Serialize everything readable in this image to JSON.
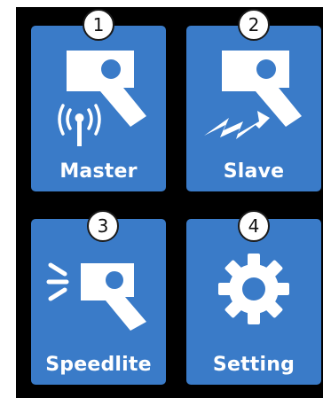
{
  "modes": [
    {
      "number": "1",
      "label": "Master",
      "icon": "master-flash-icon"
    },
    {
      "number": "2",
      "label": "Slave",
      "icon": "slave-flash-icon"
    },
    {
      "number": "3",
      "label": "Speedlite",
      "icon": "speedlite-flash-icon"
    },
    {
      "number": "4",
      "label": "Setting",
      "icon": "gear-icon"
    }
  ],
  "colors": {
    "tile": "#3a7bc8",
    "background": "#000000",
    "icon": "#ffffff"
  }
}
